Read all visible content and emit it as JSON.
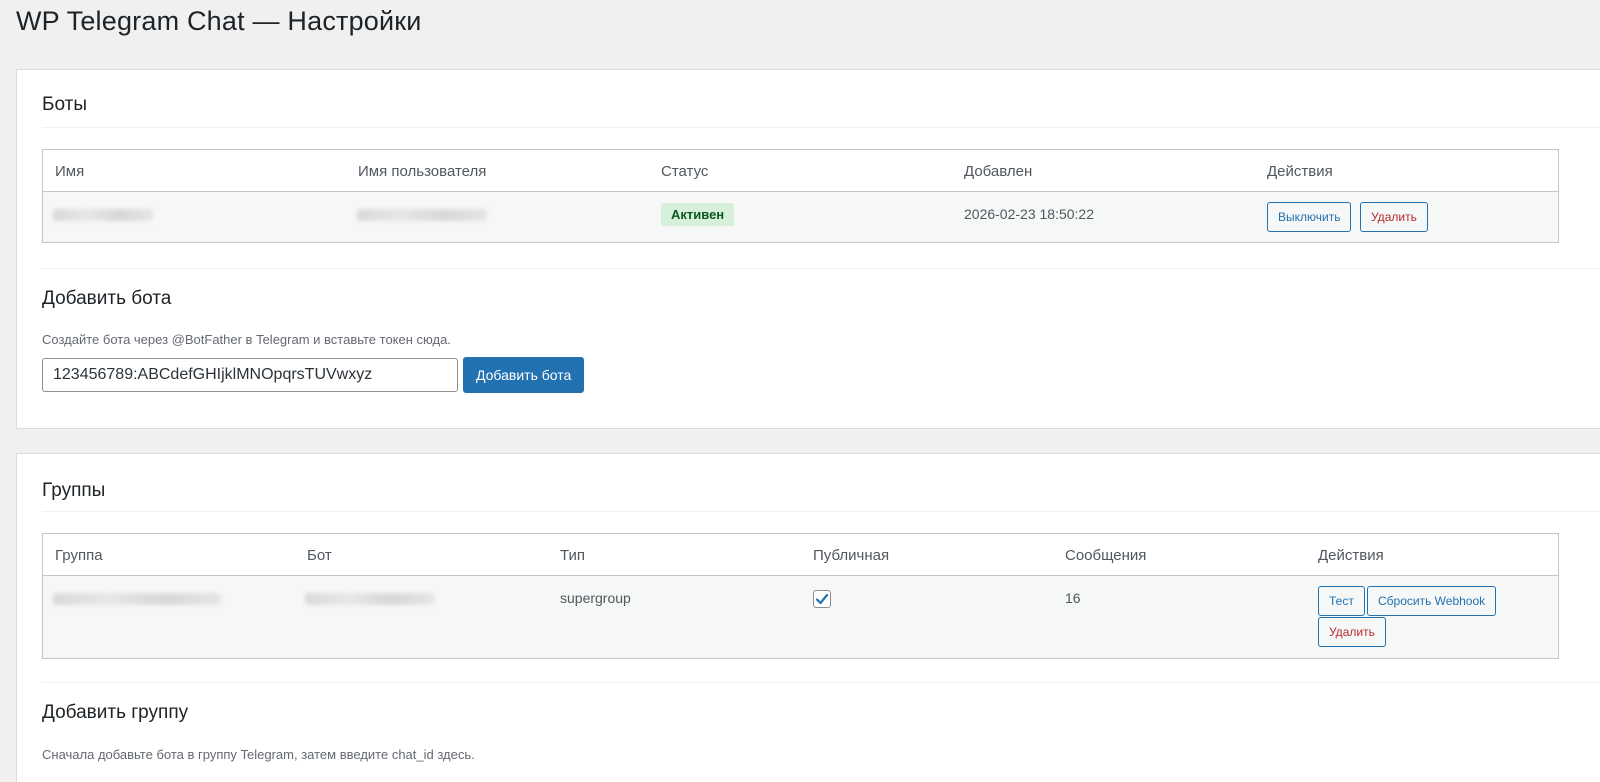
{
  "page": {
    "title": "WP Telegram Chat — Настройки"
  },
  "bots": {
    "title": "Боты",
    "columns": [
      "Имя",
      "Имя пользователя",
      "Статус",
      "Добавлен",
      "Действия"
    ],
    "row": {
      "status": "Активен",
      "added": "2026-02-23 18:50:22",
      "disable_label": "Выключить",
      "delete_label": "Удалить"
    }
  },
  "add_bot": {
    "title": "Добавить бота",
    "description": "Создайте бота через @BotFather в Telegram и вставьте токен сюда.",
    "token_value": "123456789:ABCdefGHIjklMNOpqrsTUVwxyz",
    "button_label": "Добавить бота"
  },
  "groups": {
    "title": "Группы",
    "columns": [
      "Группа",
      "Бот",
      "Тип",
      "Публичная",
      "Сообщения",
      "Действия"
    ],
    "row": {
      "type": "supergroup",
      "public": true,
      "messages": "16",
      "test_label": "Тест",
      "reset_label": "Сбросить Webhook",
      "delete_label": "Удалить"
    }
  },
  "add_group": {
    "title": "Добавить группу",
    "description": "Сначала добавьте бота в группу Telegram, затем введите chat_id здесь."
  },
  "colors": {
    "accent": "#2271b1",
    "danger": "#b32d2e",
    "status_bg": "#d7f0dc",
    "status_text": "#0a5a1e",
    "checkbox": "#2271b1"
  }
}
